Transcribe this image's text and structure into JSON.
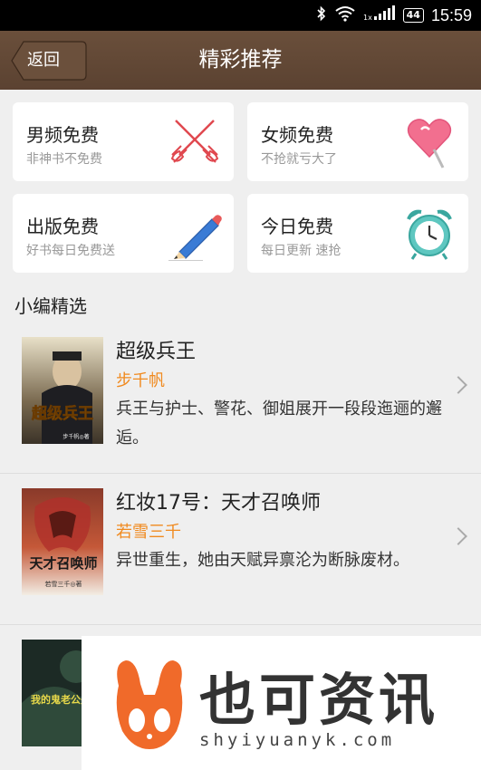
{
  "status_bar": {
    "time": "15:59",
    "battery": "44",
    "signal_label": "1x"
  },
  "header": {
    "back_label": "返回",
    "title": "精彩推荐"
  },
  "categories": [
    {
      "title": "男频免费",
      "subtitle": "非神书不免费",
      "icon": "crossed-swords-icon"
    },
    {
      "title": "女频免费",
      "subtitle": "不抢就亏大了",
      "icon": "heart-lollipop-icon"
    },
    {
      "title": "出版免费",
      "subtitle": "好书每日免费送",
      "icon": "pencil-icon"
    },
    {
      "title": "今日免费",
      "subtitle": "每日更新 速抢",
      "icon": "alarm-clock-icon"
    }
  ],
  "section": {
    "title": "小编精选"
  },
  "books": [
    {
      "title": "超级兵王",
      "author": "步千帆",
      "description": "兵王与护士、警花、御姐展开一段段迤逦的邂逅。",
      "cover_title": "超级兵王",
      "cover_author": "步千帆◎著"
    },
    {
      "title": "红妆17号：天才召唤师",
      "author": "若雪三千",
      "description": "异世重生，她由天赋异禀沦为断脉废材。",
      "cover_title": "天才召唤师",
      "cover_author": "若雪三千◎著"
    },
    {
      "cover_title": "我的鬼老公是",
      "cover_author": ""
    }
  ],
  "watermark": {
    "name": "也可资讯",
    "url": "shyiyuanyk.com"
  },
  "colors": {
    "header": "#5e4533",
    "author": "#f08a1f",
    "background": "#efefef"
  }
}
